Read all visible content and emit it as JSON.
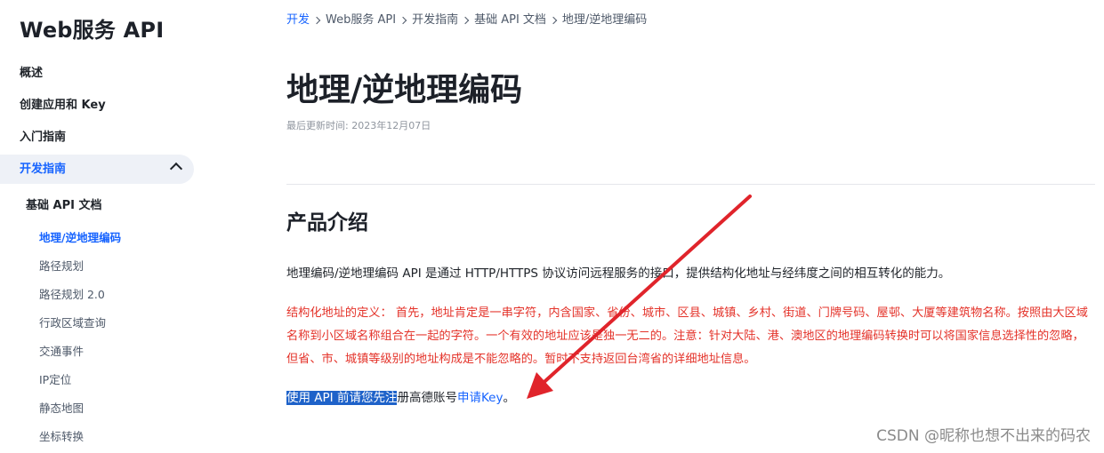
{
  "sidebar": {
    "brand": "Web服务 API",
    "items": [
      {
        "label": "概述"
      },
      {
        "label": "创建应用和 Key"
      },
      {
        "label": "入门指南"
      }
    ],
    "active_section": {
      "label": "开发指南",
      "icon": "chevron-up-icon"
    },
    "sub_group": "基础 API 文档",
    "sub_items": [
      {
        "label": "地理/逆地理编码",
        "active": true
      },
      {
        "label": "路径规划"
      },
      {
        "label": "路径规划 2.0"
      },
      {
        "label": "行政区域查询"
      },
      {
        "label": "交通事件"
      },
      {
        "label": "IP定位"
      },
      {
        "label": "静态地图"
      },
      {
        "label": "坐标转换"
      }
    ]
  },
  "breadcrumb": [
    "开发",
    "Web服务 API",
    "开发指南",
    "基础 API 文档",
    "地理/逆地理编码"
  ],
  "page": {
    "title": "地理/逆地理编码",
    "updated": "最后更新时间: 2023年12月07日",
    "section_title": "产品介绍",
    "intro": "地理编码/逆地理编码 API 是通过 HTTP/HTTPS 协议访问远程服务的接口，提供结构化地址与经纬度之间的相互转化的能力。",
    "definition": "结构化地址的定义：  首先，地址肯定是一串字符，内含国家、省份、城市、区县、城镇、乡村、街道、门牌号码、屋邨、大厦等建筑物名称。按照由大区域名称到小区域名称组合在一起的字符。一个有效的地址应该是独一无二的。注意：针对大陆、港、澳地区的地理编码转换时可以将国家信息选择性的忽略，但省、市、城镇等级别的地址构成是不能忽略的。暂时不支持返回台湾省的详细地址信息。",
    "key_selected": "使用 API 前请您先注",
    "key_rest": "册高德账号",
    "key_link": "申请Key",
    "key_end": "。"
  },
  "watermark": "CSDN @昵称也想不出来的码农",
  "colors": {
    "accent": "#1764ff",
    "warning_text": "#e4332a",
    "annotation_arrow": "#e0242b",
    "selection": "#1e62c9"
  }
}
